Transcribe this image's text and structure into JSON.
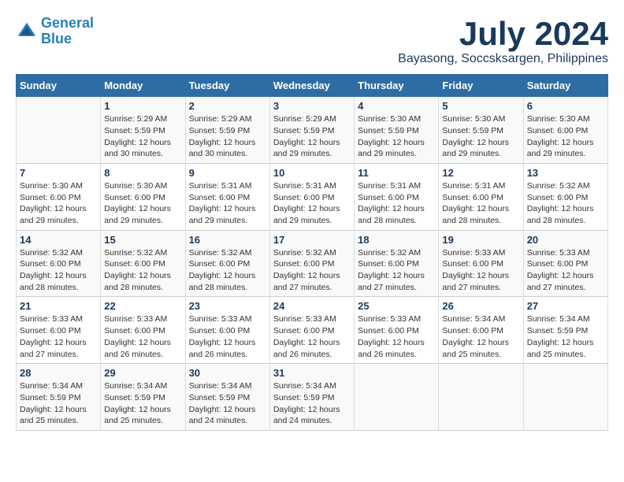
{
  "logo": {
    "line1": "General",
    "line2": "Blue"
  },
  "title": "July 2024",
  "location": "Bayasong, Soccsksargen, Philippines",
  "weekdays": [
    "Sunday",
    "Monday",
    "Tuesday",
    "Wednesday",
    "Thursday",
    "Friday",
    "Saturday"
  ],
  "weeks": [
    [
      {
        "day": "",
        "info": ""
      },
      {
        "day": "1",
        "info": "Sunrise: 5:29 AM\nSunset: 5:59 PM\nDaylight: 12 hours\nand 30 minutes."
      },
      {
        "day": "2",
        "info": "Sunrise: 5:29 AM\nSunset: 5:59 PM\nDaylight: 12 hours\nand 30 minutes."
      },
      {
        "day": "3",
        "info": "Sunrise: 5:29 AM\nSunset: 5:59 PM\nDaylight: 12 hours\nand 29 minutes."
      },
      {
        "day": "4",
        "info": "Sunrise: 5:30 AM\nSunset: 5:59 PM\nDaylight: 12 hours\nand 29 minutes."
      },
      {
        "day": "5",
        "info": "Sunrise: 5:30 AM\nSunset: 5:59 PM\nDaylight: 12 hours\nand 29 minutes."
      },
      {
        "day": "6",
        "info": "Sunrise: 5:30 AM\nSunset: 6:00 PM\nDaylight: 12 hours\nand 29 minutes."
      }
    ],
    [
      {
        "day": "7",
        "info": "Sunrise: 5:30 AM\nSunset: 6:00 PM\nDaylight: 12 hours\nand 29 minutes."
      },
      {
        "day": "8",
        "info": "Sunrise: 5:30 AM\nSunset: 6:00 PM\nDaylight: 12 hours\nand 29 minutes."
      },
      {
        "day": "9",
        "info": "Sunrise: 5:31 AM\nSunset: 6:00 PM\nDaylight: 12 hours\nand 29 minutes."
      },
      {
        "day": "10",
        "info": "Sunrise: 5:31 AM\nSunset: 6:00 PM\nDaylight: 12 hours\nand 29 minutes."
      },
      {
        "day": "11",
        "info": "Sunrise: 5:31 AM\nSunset: 6:00 PM\nDaylight: 12 hours\nand 28 minutes."
      },
      {
        "day": "12",
        "info": "Sunrise: 5:31 AM\nSunset: 6:00 PM\nDaylight: 12 hours\nand 28 minutes."
      },
      {
        "day": "13",
        "info": "Sunrise: 5:32 AM\nSunset: 6:00 PM\nDaylight: 12 hours\nand 28 minutes."
      }
    ],
    [
      {
        "day": "14",
        "info": "Sunrise: 5:32 AM\nSunset: 6:00 PM\nDaylight: 12 hours\nand 28 minutes."
      },
      {
        "day": "15",
        "info": "Sunrise: 5:32 AM\nSunset: 6:00 PM\nDaylight: 12 hours\nand 28 minutes."
      },
      {
        "day": "16",
        "info": "Sunrise: 5:32 AM\nSunset: 6:00 PM\nDaylight: 12 hours\nand 28 minutes."
      },
      {
        "day": "17",
        "info": "Sunrise: 5:32 AM\nSunset: 6:00 PM\nDaylight: 12 hours\nand 27 minutes."
      },
      {
        "day": "18",
        "info": "Sunrise: 5:32 AM\nSunset: 6:00 PM\nDaylight: 12 hours\nand 27 minutes."
      },
      {
        "day": "19",
        "info": "Sunrise: 5:33 AM\nSunset: 6:00 PM\nDaylight: 12 hours\nand 27 minutes."
      },
      {
        "day": "20",
        "info": "Sunrise: 5:33 AM\nSunset: 6:00 PM\nDaylight: 12 hours\nand 27 minutes."
      }
    ],
    [
      {
        "day": "21",
        "info": "Sunrise: 5:33 AM\nSunset: 6:00 PM\nDaylight: 12 hours\nand 27 minutes."
      },
      {
        "day": "22",
        "info": "Sunrise: 5:33 AM\nSunset: 6:00 PM\nDaylight: 12 hours\nand 26 minutes."
      },
      {
        "day": "23",
        "info": "Sunrise: 5:33 AM\nSunset: 6:00 PM\nDaylight: 12 hours\nand 26 minutes."
      },
      {
        "day": "24",
        "info": "Sunrise: 5:33 AM\nSunset: 6:00 PM\nDaylight: 12 hours\nand 26 minutes."
      },
      {
        "day": "25",
        "info": "Sunrise: 5:33 AM\nSunset: 6:00 PM\nDaylight: 12 hours\nand 26 minutes."
      },
      {
        "day": "26",
        "info": "Sunrise: 5:34 AM\nSunset: 6:00 PM\nDaylight: 12 hours\nand 25 minutes."
      },
      {
        "day": "27",
        "info": "Sunrise: 5:34 AM\nSunset: 5:59 PM\nDaylight: 12 hours\nand 25 minutes."
      }
    ],
    [
      {
        "day": "28",
        "info": "Sunrise: 5:34 AM\nSunset: 5:59 PM\nDaylight: 12 hours\nand 25 minutes."
      },
      {
        "day": "29",
        "info": "Sunrise: 5:34 AM\nSunset: 5:59 PM\nDaylight: 12 hours\nand 25 minutes."
      },
      {
        "day": "30",
        "info": "Sunrise: 5:34 AM\nSunset: 5:59 PM\nDaylight: 12 hours\nand 24 minutes."
      },
      {
        "day": "31",
        "info": "Sunrise: 5:34 AM\nSunset: 5:59 PM\nDaylight: 12 hours\nand 24 minutes."
      },
      {
        "day": "",
        "info": ""
      },
      {
        "day": "",
        "info": ""
      },
      {
        "day": "",
        "info": ""
      }
    ]
  ]
}
